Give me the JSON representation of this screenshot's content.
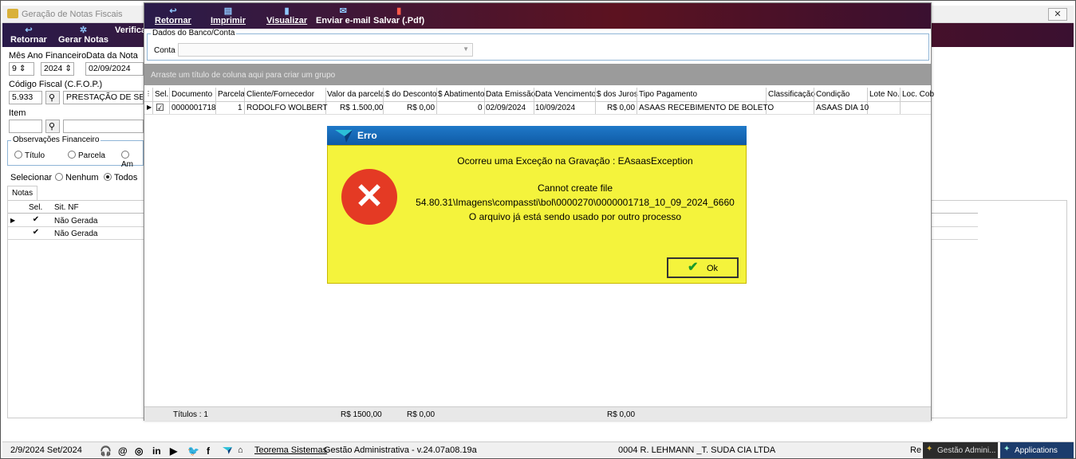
{
  "back_window": {
    "title": "Geração de Notas Fiscais",
    "close": "✕",
    "toolbar": [
      {
        "label": "Retornar",
        "icon": "↩"
      },
      {
        "label": "Gerar Notas",
        "icon": "✲"
      },
      {
        "label": "Verifica",
        "icon": ""
      }
    ],
    "fields": {
      "mes_ano_label": "Mês Ano Financeiro",
      "mes": "9",
      "ano": "2024",
      "data_nota_label": "Data da Nota",
      "data_nota": "02/09/2024",
      "cfop_label": "Código Fiscal (C.F.O.P.)",
      "cfop": "5.933",
      "cfop_desc": "PRESTAÇÃO DE SERVIÇO",
      "item_label": "Item",
      "item_code": "",
      "item_desc": ""
    },
    "observacoes": {
      "legend": "Observações Financeiro",
      "options": [
        "Título",
        "Parcela",
        "Am"
      ]
    },
    "selecionar": {
      "label": "Selecionar",
      "options": [
        "Nenhum",
        "Todos"
      ],
      "selected": "Todos"
    },
    "tab": "Notas",
    "grid": {
      "headers": [
        "Sel.",
        "Sit. NF"
      ],
      "rows": [
        {
          "sel": "✔",
          "sit": "Não Gerada"
        },
        {
          "sel": "✔",
          "sit": "Não Gerada"
        }
      ]
    }
  },
  "front_window": {
    "toolbar": [
      {
        "label": "Retornar",
        "icon": "↩"
      },
      {
        "label": "Imprimir",
        "icon": "▤"
      },
      {
        "label": "Visualizar",
        "icon": "▮"
      },
      {
        "label": "Enviar e-mail",
        "icon": "✉"
      },
      {
        "label": "Salvar (.Pdf)",
        "icon": "▮"
      }
    ],
    "banco": {
      "legend": "Dados do Banco/Conta",
      "conta_label": "Conta",
      "conta_value": ""
    },
    "group_hint": "Arraste um título de coluna aqui para criar um grupo",
    "columns": [
      "Sel.",
      "Documento",
      "Parcela",
      "Cliente/Fornecedor",
      "Valor da parcela",
      "$ do Desconto",
      "$ Abatimento",
      "Data Emissão",
      "Data Vencimento",
      "$ dos Juros",
      "Tipo Pagamento",
      "Classificação",
      "Condição",
      "Lote No.",
      "Loc. Cob"
    ],
    "row": {
      "sel": "☑",
      "documento": "0000001718",
      "parcela": "1",
      "cliente": "RODOLFO WOLBERT",
      "valor": "R$ 1.500,00",
      "desconto": "R$ 0,00",
      "abatimento": "0",
      "emissao": "02/09/2024",
      "vencimento": "10/09/2024",
      "juros": "R$ 0,00",
      "tipo": "ASAAS RECEBIMENTO DE BOLETO",
      "classificacao": "",
      "condicao": "ASAAS DIA 10",
      "lote": "",
      "loc": ""
    },
    "footer": {
      "titulos": "Títulos : 1",
      "valor": "R$ 1500,00",
      "desconto": "R$ 0,00",
      "juros": "R$ 0,00"
    }
  },
  "dialog": {
    "title": "Erro",
    "line1": "Ocorreu uma Exceção na Gravação : EAsaasException",
    "line2": "Cannot create file",
    "line3": "54.80.31\\Imagens\\compassti\\bol\\0000270\\0000001718_10_09_2024_6660",
    "line4": "O arquivo já está sendo usado por outro processo",
    "ok": "Ok",
    "error_symbol": "✕",
    "colors": {
      "body": "#f4f33c",
      "title": "#1060b0",
      "icon": "#e43a24"
    }
  },
  "statusbar": {
    "date": "2/9/2024 Set/2024",
    "social": [
      "🎧",
      "@",
      "◎",
      "in",
      "▶",
      "🐦",
      "f"
    ],
    "brand": "Teorema Sistemas",
    "version": "Gestão Administrativa - v.24.07a08.19a",
    "company": "0004 R. LEHMANN _T. SUDA CIA LTDA",
    "re": "Re",
    "task1": "Gestão Admini...",
    "task2": "Applications"
  }
}
